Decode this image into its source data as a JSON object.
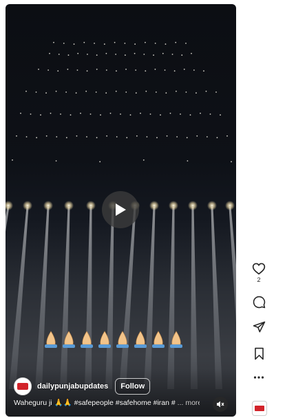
{
  "reel": {
    "author": "dailypunjabupdates",
    "follow_label": "Follow",
    "caption_text": "Waheguru ji 🙏🙏 #safepeople #safehome #iran #",
    "caption_more": "... more"
  },
  "actions": {
    "like_count": "2"
  },
  "icons": {
    "play": "play-icon",
    "mute": "muted-speaker-icon",
    "like": "heart-icon",
    "comment": "comment-bubble-icon",
    "share": "paper-plane-icon",
    "save": "bookmark-icon",
    "more": "more-horizontal-icon"
  },
  "colors": {
    "brand_red": "#d2232a",
    "icon": "#262626",
    "text_on_video": "#ffffff"
  }
}
